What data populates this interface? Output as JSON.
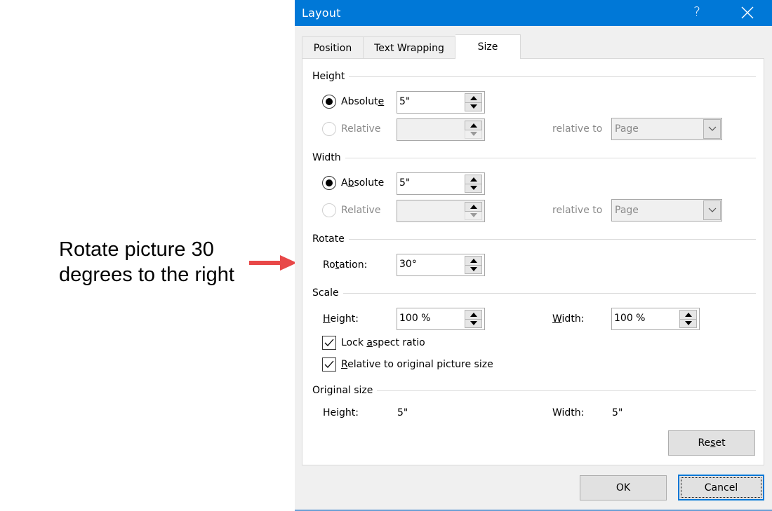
{
  "annotation": {
    "text": "Rotate picture 30\ndegrees to the right",
    "arrow_color": "#e84848"
  },
  "dialog": {
    "title": "Layout",
    "help_label": "?",
    "title_bar_color": "#0078d7",
    "tabs": [
      {
        "label": "Position",
        "active": false
      },
      {
        "label": "Text Wrapping",
        "active": false
      },
      {
        "label": "Size",
        "active": true
      }
    ],
    "height_section": {
      "title": "Height",
      "absolute_label": "Absolute",
      "absolute_selected": true,
      "absolute_value": "5\"",
      "relative_label": "Relative",
      "relative_selected": false,
      "relative_value": "",
      "relative_to_label": "relative to",
      "relative_to_value": "Page"
    },
    "width_section": {
      "title": "Width",
      "absolute_label": "Absolute",
      "absolute_selected": true,
      "absolute_value": "5\"",
      "relative_label": "Relative",
      "relative_selected": false,
      "relative_value": "",
      "relative_to_label": "relative to",
      "relative_to_value": "Page"
    },
    "rotate_section": {
      "title": "Rotate",
      "rotation_label": "Rotation:",
      "rotation_value": "30°"
    },
    "scale_section": {
      "title": "Scale",
      "height_label": "Height:",
      "height_value": "100 %",
      "width_label": "Width:",
      "width_value": "100 %",
      "lock_aspect_label": "Lock aspect ratio",
      "lock_aspect_checked": true,
      "relative_original_label": "Relative to original picture size",
      "relative_original_checked": true
    },
    "original_size_section": {
      "title": "Original size",
      "height_label": "Height:",
      "height_value": "5\"",
      "width_label": "Width:",
      "width_value": "5\""
    },
    "buttons": {
      "reset": "Reset",
      "ok": "OK",
      "cancel": "Cancel"
    }
  }
}
